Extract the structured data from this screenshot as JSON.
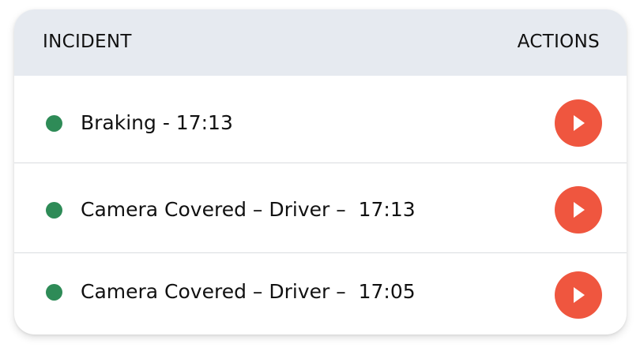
{
  "table": {
    "header": {
      "incident_label": "INCIDENT",
      "actions_label": "ACTIONS"
    },
    "rows": [
      {
        "label": "Braking - 17:13",
        "status_color": "#2e8b57",
        "action_icon": "play-icon"
      },
      {
        "label": "Camera Covered – Driver –  17:13",
        "status_color": "#2e8b57",
        "action_icon": "play-icon"
      },
      {
        "label": "Camera Covered – Driver –  17:05",
        "status_color": "#2e8b57",
        "action_icon": "play-icon"
      }
    ]
  },
  "colors": {
    "header_background": "#e6eaf0",
    "status_ok": "#2e8b57",
    "action_button": "#ef563f"
  }
}
